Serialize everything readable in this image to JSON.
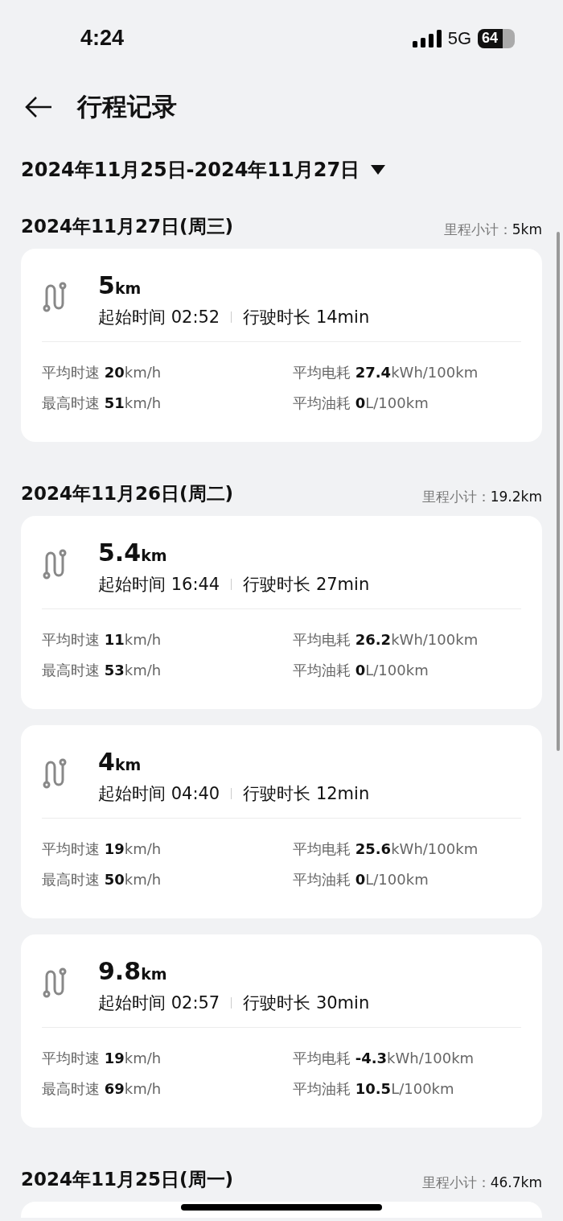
{
  "status_bar": {
    "time": "4:24",
    "network": "5G",
    "battery": "64"
  },
  "header": {
    "title": "行程记录"
  },
  "date_range": {
    "label": "2024年11月25日-2024年11月27日"
  },
  "groups": [
    {
      "date": "2024年11月27日(周三)",
      "subtotal_label": "里程小计：",
      "subtotal": "5km",
      "trips": [
        {
          "distance": "5",
          "unit": "km",
          "start_label": "起始时间",
          "start": "02:52",
          "duration_label": "行驶时长",
          "duration": "14min",
          "stats": [
            {
              "label": "平均时速",
              "value": "**20**km/h"
            },
            {
              "label": "平均电耗",
              "value": "**27.4**kWh/100km"
            },
            {
              "label": "最高时速",
              "value": "**51**km/h"
            },
            {
              "label": "平均油耗",
              "value": "**0**L/100km"
            }
          ]
        }
      ]
    },
    {
      "date": "2024年11月26日(周二)",
      "subtotal_label": "里程小计：",
      "subtotal": "19.2km",
      "trips": [
        {
          "distance": "5.4",
          "unit": "km",
          "start_label": "起始时间",
          "start": "16:44",
          "duration_label": "行驶时长",
          "duration": "27min",
          "stats": [
            {
              "label": "平均时速",
              "value": "**11**km/h"
            },
            {
              "label": "平均电耗",
              "value": "**26.2**kWh/100km"
            },
            {
              "label": "最高时速",
              "value": "**53**km/h"
            },
            {
              "label": "平均油耗",
              "value": "**0**L/100km"
            }
          ]
        },
        {
          "distance": "4",
          "unit": "km",
          "start_label": "起始时间",
          "start": "04:40",
          "duration_label": "行驶时长",
          "duration": "12min",
          "stats": [
            {
              "label": "平均时速",
              "value": "**19**km/h"
            },
            {
              "label": "平均电耗",
              "value": "**25.6**kWh/100km"
            },
            {
              "label": "最高时速",
              "value": "**50**km/h"
            },
            {
              "label": "平均油耗",
              "value": "**0**L/100km"
            }
          ]
        },
        {
          "distance": "9.8",
          "unit": "km",
          "start_label": "起始时间",
          "start": "02:57",
          "duration_label": "行驶时长",
          "duration": "30min",
          "stats": [
            {
              "label": "平均时速",
              "value": "**19**km/h"
            },
            {
              "label": "平均电耗",
              "value": "**-4.3**kWh/100km"
            },
            {
              "label": "最高时速",
              "value": "**69**km/h"
            },
            {
              "label": "平均油耗",
              "value": "**10.5**L/100km"
            }
          ]
        }
      ]
    },
    {
      "date": "2024年11月25日(周一)",
      "subtotal_label": "里程小计：",
      "subtotal": "46.7km"
    }
  ]
}
